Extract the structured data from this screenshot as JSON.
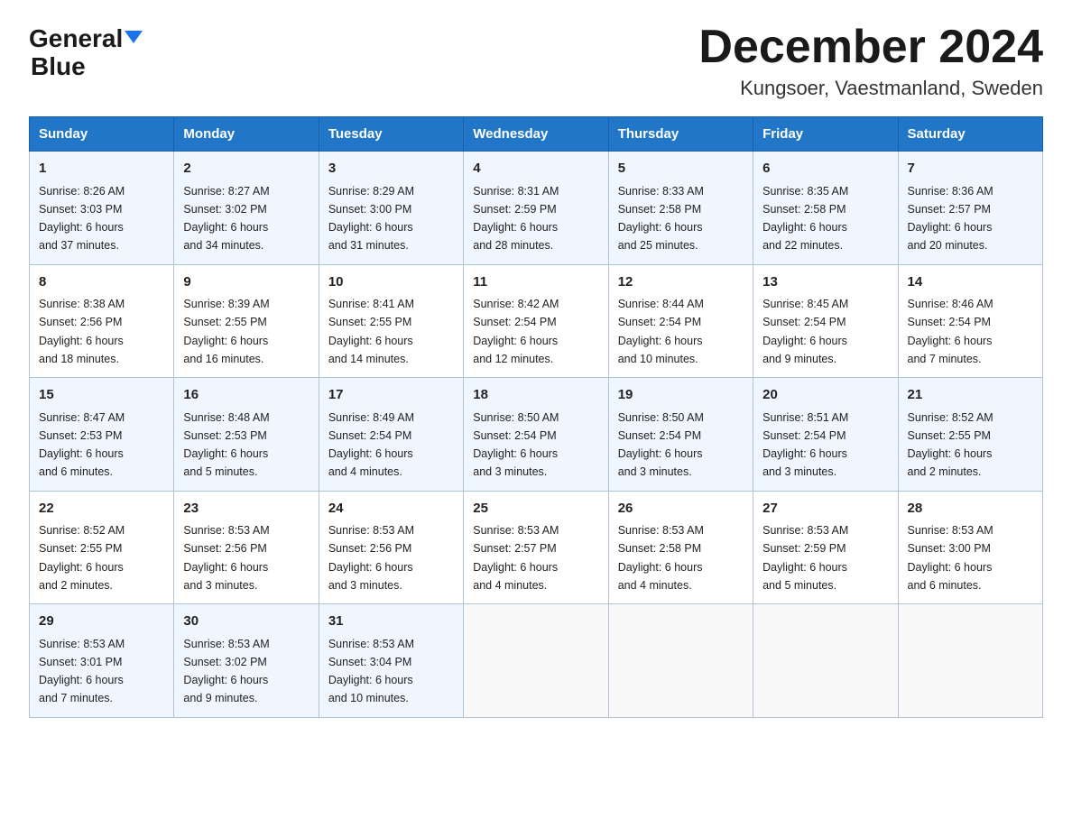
{
  "header": {
    "logo_general": "General",
    "logo_blue": "Blue",
    "month_title": "December 2024",
    "location": "Kungsoer, Vaestmanland, Sweden"
  },
  "weekdays": [
    "Sunday",
    "Monday",
    "Tuesday",
    "Wednesday",
    "Thursday",
    "Friday",
    "Saturday"
  ],
  "weeks": [
    [
      {
        "day": "1",
        "sunrise": "8:26 AM",
        "sunset": "3:03 PM",
        "daylight": "6 hours and 37 minutes."
      },
      {
        "day": "2",
        "sunrise": "8:27 AM",
        "sunset": "3:02 PM",
        "daylight": "6 hours and 34 minutes."
      },
      {
        "day": "3",
        "sunrise": "8:29 AM",
        "sunset": "3:00 PM",
        "daylight": "6 hours and 31 minutes."
      },
      {
        "day": "4",
        "sunrise": "8:31 AM",
        "sunset": "2:59 PM",
        "daylight": "6 hours and 28 minutes."
      },
      {
        "day": "5",
        "sunrise": "8:33 AM",
        "sunset": "2:58 PM",
        "daylight": "6 hours and 25 minutes."
      },
      {
        "day": "6",
        "sunrise": "8:35 AM",
        "sunset": "2:58 PM",
        "daylight": "6 hours and 22 minutes."
      },
      {
        "day": "7",
        "sunrise": "8:36 AM",
        "sunset": "2:57 PM",
        "daylight": "6 hours and 20 minutes."
      }
    ],
    [
      {
        "day": "8",
        "sunrise": "8:38 AM",
        "sunset": "2:56 PM",
        "daylight": "6 hours and 18 minutes."
      },
      {
        "day": "9",
        "sunrise": "8:39 AM",
        "sunset": "2:55 PM",
        "daylight": "6 hours and 16 minutes."
      },
      {
        "day": "10",
        "sunrise": "8:41 AM",
        "sunset": "2:55 PM",
        "daylight": "6 hours and 14 minutes."
      },
      {
        "day": "11",
        "sunrise": "8:42 AM",
        "sunset": "2:54 PM",
        "daylight": "6 hours and 12 minutes."
      },
      {
        "day": "12",
        "sunrise": "8:44 AM",
        "sunset": "2:54 PM",
        "daylight": "6 hours and 10 minutes."
      },
      {
        "day": "13",
        "sunrise": "8:45 AM",
        "sunset": "2:54 PM",
        "daylight": "6 hours and 9 minutes."
      },
      {
        "day": "14",
        "sunrise": "8:46 AM",
        "sunset": "2:54 PM",
        "daylight": "6 hours and 7 minutes."
      }
    ],
    [
      {
        "day": "15",
        "sunrise": "8:47 AM",
        "sunset": "2:53 PM",
        "daylight": "6 hours and 6 minutes."
      },
      {
        "day": "16",
        "sunrise": "8:48 AM",
        "sunset": "2:53 PM",
        "daylight": "6 hours and 5 minutes."
      },
      {
        "day": "17",
        "sunrise": "8:49 AM",
        "sunset": "2:54 PM",
        "daylight": "6 hours and 4 minutes."
      },
      {
        "day": "18",
        "sunrise": "8:50 AM",
        "sunset": "2:54 PM",
        "daylight": "6 hours and 3 minutes."
      },
      {
        "day": "19",
        "sunrise": "8:50 AM",
        "sunset": "2:54 PM",
        "daylight": "6 hours and 3 minutes."
      },
      {
        "day": "20",
        "sunrise": "8:51 AM",
        "sunset": "2:54 PM",
        "daylight": "6 hours and 3 minutes."
      },
      {
        "day": "21",
        "sunrise": "8:52 AM",
        "sunset": "2:55 PM",
        "daylight": "6 hours and 2 minutes."
      }
    ],
    [
      {
        "day": "22",
        "sunrise": "8:52 AM",
        "sunset": "2:55 PM",
        "daylight": "6 hours and 2 minutes."
      },
      {
        "day": "23",
        "sunrise": "8:53 AM",
        "sunset": "2:56 PM",
        "daylight": "6 hours and 3 minutes."
      },
      {
        "day": "24",
        "sunrise": "8:53 AM",
        "sunset": "2:56 PM",
        "daylight": "6 hours and 3 minutes."
      },
      {
        "day": "25",
        "sunrise": "8:53 AM",
        "sunset": "2:57 PM",
        "daylight": "6 hours and 4 minutes."
      },
      {
        "day": "26",
        "sunrise": "8:53 AM",
        "sunset": "2:58 PM",
        "daylight": "6 hours and 4 minutes."
      },
      {
        "day": "27",
        "sunrise": "8:53 AM",
        "sunset": "2:59 PM",
        "daylight": "6 hours and 5 minutes."
      },
      {
        "day": "28",
        "sunrise": "8:53 AM",
        "sunset": "3:00 PM",
        "daylight": "6 hours and 6 minutes."
      }
    ],
    [
      {
        "day": "29",
        "sunrise": "8:53 AM",
        "sunset": "3:01 PM",
        "daylight": "6 hours and 7 minutes."
      },
      {
        "day": "30",
        "sunrise": "8:53 AM",
        "sunset": "3:02 PM",
        "daylight": "6 hours and 9 minutes."
      },
      {
        "day": "31",
        "sunrise": "8:53 AM",
        "sunset": "3:04 PM",
        "daylight": "6 hours and 10 minutes."
      },
      null,
      null,
      null,
      null
    ]
  ],
  "labels": {
    "sunrise": "Sunrise:",
    "sunset": "Sunset:",
    "daylight": "Daylight:"
  }
}
